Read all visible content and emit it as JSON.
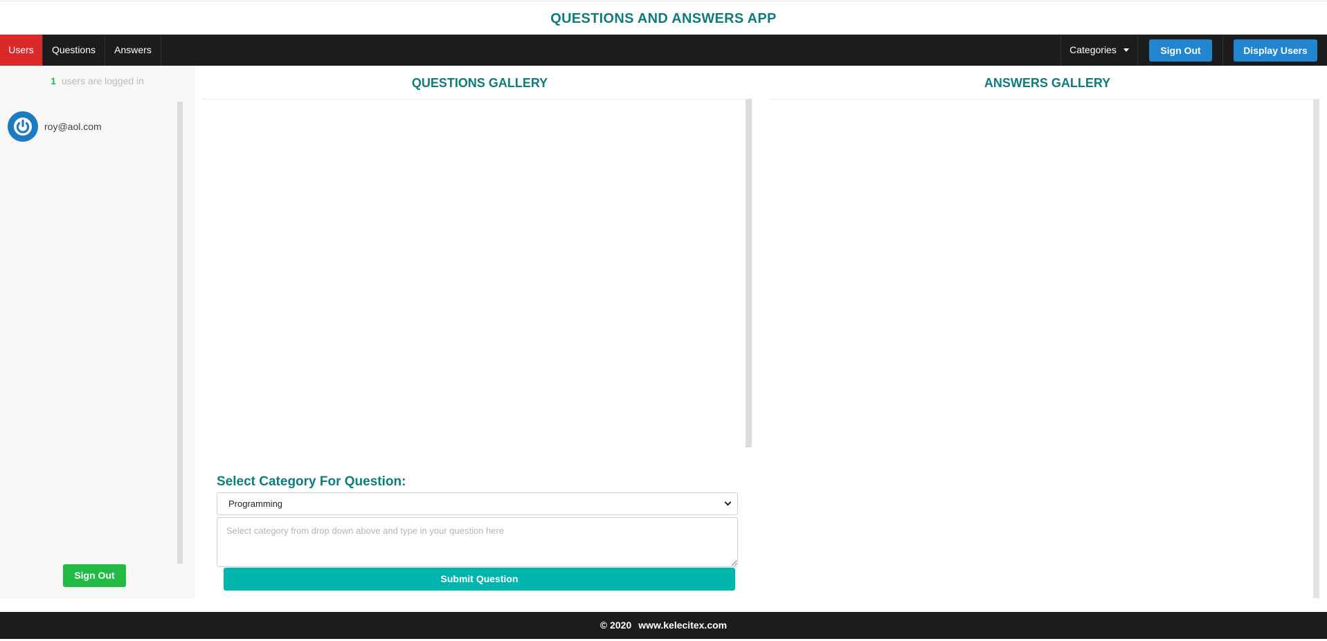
{
  "app": {
    "title": "QUESTIONS AND ANSWERS APP"
  },
  "nav": {
    "items": [
      {
        "label": "Users",
        "active": true
      },
      {
        "label": "Questions",
        "active": false
      },
      {
        "label": "Answers",
        "active": false
      }
    ],
    "categories_label": "Categories",
    "sign_out_label": "Sign Out",
    "display_users_label": "Display Users"
  },
  "sidebar": {
    "logged_in_count": "1",
    "logged_in_text": "users are logged in",
    "users": [
      {
        "email": "roy@aol.com",
        "icon": "power-icon"
      }
    ],
    "sign_out_label": "Sign Out"
  },
  "questions_gallery": {
    "title": "QUESTIONS GALLERY"
  },
  "answers_gallery": {
    "title": "ANSWERS GALLERY"
  },
  "question_form": {
    "label": "Select Category For Question:",
    "selected_category": "Programming",
    "placeholder": "Select category from drop down above and type in your question here",
    "submit_label": "Submit Question"
  },
  "footer": {
    "copyright": "© 2020",
    "site": "www.kelecitex.com"
  },
  "colors": {
    "accent_teal": "#0e7c7b",
    "nav_bg": "#1b1c1d",
    "active_red": "#db2828",
    "primary_blue": "#2185d0",
    "success_green": "#21ba45",
    "submit_teal": "#00b5ad"
  }
}
